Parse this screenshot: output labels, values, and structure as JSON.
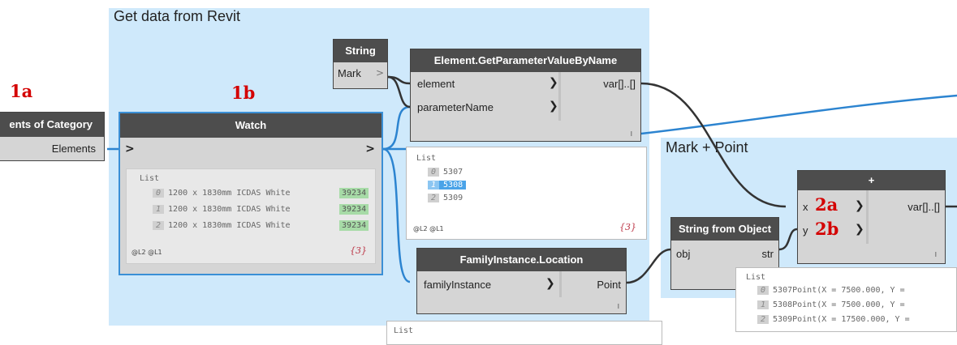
{
  "groups": {
    "revit": {
      "title": "Get data from Revit"
    },
    "mark_point": {
      "title": "Mark + Point"
    }
  },
  "labels": {
    "l1a": "1a",
    "l1b": "1b",
    "l2a": "2a",
    "l2b": "2b"
  },
  "nodes": {
    "category": {
      "title": "ents of Category",
      "output": "Elements"
    },
    "watch": {
      "title": "Watch",
      "in": ">",
      "out": ">",
      "list_label": "List",
      "items": [
        {
          "index": "0",
          "text": "1200 x 1830mm ICDAS White",
          "value": "39234"
        },
        {
          "index": "1",
          "text": "1200 x 1830mm ICDAS White",
          "value": "39234"
        },
        {
          "index": "2",
          "text": "1200 x 1830mm ICDAS White",
          "value": "39234"
        }
      ],
      "levels": "@L2 @L1",
      "count": "{3}"
    },
    "string": {
      "title": "String",
      "value": "Mark",
      "out": ">"
    },
    "get_param": {
      "title": "Element.GetParameterValueByName",
      "in1": "element",
      "in2": "parameterName",
      "out": "var[]..[]",
      "lacing": "l",
      "list_label": "List",
      "items": [
        {
          "index": "0",
          "text": "5307"
        },
        {
          "index": "1",
          "text": "5308"
        },
        {
          "index": "2",
          "text": "5309"
        }
      ],
      "levels": "@L2 @L1",
      "count": "{3}"
    },
    "location": {
      "title": "FamilyInstance.Location",
      "in": "familyInstance",
      "out": "Point",
      "lacing": "l",
      "preview_label": "List"
    },
    "string_from_object": {
      "title": "String from Object",
      "in": "obj",
      "out": "str"
    },
    "plus": {
      "title": "+",
      "in1": "x",
      "in2": "y",
      "out": "var[]..[]",
      "lacing": "l",
      "list_label": "List",
      "items": [
        {
          "index": "0",
          "text": "5307Point(X = 7500.000, Y ="
        },
        {
          "index": "1",
          "text": "5308Point(X = 7500.000, Y ="
        },
        {
          "index": "2",
          "text": "5309Point(X = 17500.000, Y ="
        }
      ]
    }
  },
  "colors": {
    "group_bg": "#cfe9fb",
    "node_header": "#4d4d4d",
    "node_body": "#d5d5d5",
    "red_label": "#d40000",
    "wire_blue": "#2c84d0",
    "wire_dark": "#333333",
    "highlight": "#3a8fd6",
    "value_green": "#a7dba7"
  }
}
